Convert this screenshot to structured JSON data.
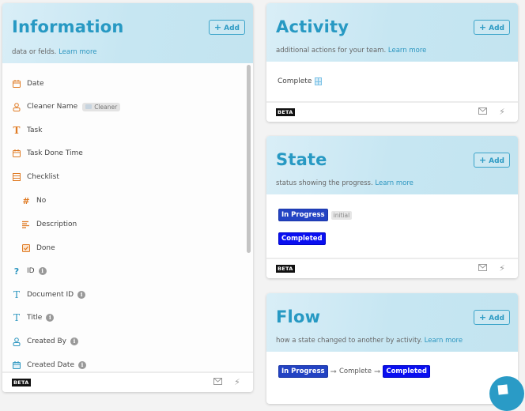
{
  "info": {
    "title": "Information",
    "add_label": "Add",
    "description": "data or felds.",
    "learn_more": "Learn more",
    "fields": [
      {
        "label": "Date",
        "icon": "calendar-icon",
        "color": "orange"
      },
      {
        "label": "Cleaner Name",
        "icon": "user-icon",
        "color": "orange",
        "tag": "Cleaner"
      },
      {
        "label": "Task",
        "icon": "text-icon",
        "color": "orange"
      },
      {
        "label": "Task Done Time",
        "icon": "calendar-icon",
        "color": "orange"
      },
      {
        "label": "Checklist",
        "icon": "table-icon",
        "color": "orange"
      },
      {
        "label": "No",
        "icon": "hash-icon",
        "color": "orange",
        "sub": true
      },
      {
        "label": "Description",
        "icon": "paragraph-icon",
        "color": "orange",
        "sub": true
      },
      {
        "label": "Done",
        "icon": "checkbox-icon",
        "color": "orange",
        "sub": true
      },
      {
        "label": "ID",
        "icon": "question-icon",
        "color": "blue",
        "info": true
      },
      {
        "label": "Document ID",
        "icon": "text-icon",
        "color": "blue",
        "info": true
      },
      {
        "label": "Title",
        "icon": "text-icon",
        "color": "blue",
        "info": true
      },
      {
        "label": "Created By",
        "icon": "user-icon",
        "color": "blue",
        "info": true
      },
      {
        "label": "Created Date",
        "icon": "calendar-icon",
        "color": "blue",
        "info": true
      }
    ],
    "beta": "BETA"
  },
  "activity": {
    "title": "Activity",
    "add_label": "Add",
    "description": "additional actions for your team.",
    "learn_more": "Learn more",
    "items": [
      "Complete"
    ],
    "beta": "BETA"
  },
  "state": {
    "title": "State",
    "add_label": "Add",
    "description": "status showing the progress.",
    "learn_more": "Learn more",
    "states": [
      {
        "label": "In Progress",
        "tag": "initial",
        "color": "#2343c3"
      },
      {
        "label": "Completed",
        "color": "#0a0ff0"
      }
    ],
    "beta": "BETA"
  },
  "flow": {
    "title": "Flow",
    "add_label": "Add",
    "description": "how a state changed to another by activity.",
    "learn_more": "Learn more",
    "from": "In Progress",
    "activity": "Complete",
    "to": "Completed"
  },
  "colors": {
    "accent": "#2799c3",
    "orange": "#e07b24"
  }
}
